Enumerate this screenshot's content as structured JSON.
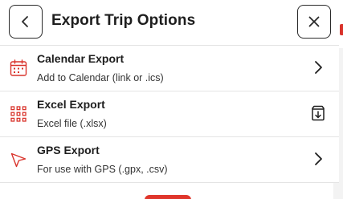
{
  "header": {
    "title": "Export Trip Options",
    "back_icon": "chevron-left-icon",
    "close_icon": "close-icon"
  },
  "colors": {
    "accent_red": "#d9332b",
    "text": "#1e1e1e",
    "divider": "#e4e4e4"
  },
  "options": [
    {
      "title": "Calendar Export",
      "subtitle": "Add to Calendar (link or .ics)",
      "icon": "calendar-icon",
      "action_icon": "chevron-right-icon"
    },
    {
      "title": "Excel Export",
      "subtitle": "Excel file (.xlsx)",
      "icon": "grid-icon",
      "action_icon": "download-icon"
    },
    {
      "title": "GPS Export",
      "subtitle": "For use with GPS (.gpx, .csv)",
      "icon": "navigation-arrow-icon",
      "action_icon": "chevron-right-icon"
    }
  ]
}
